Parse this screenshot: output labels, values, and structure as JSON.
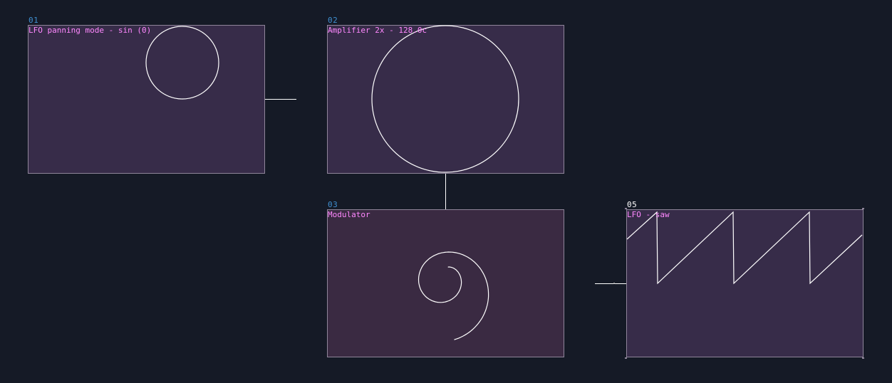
{
  "nodes": [
    {
      "id": "01",
      "title": "LFO panning mode - sin (0)",
      "fill": "#372c49",
      "active": false
    },
    {
      "id": "02",
      "title": "Amplifier 2x - 128.0c",
      "fill": "#372c49",
      "active": false
    },
    {
      "id": "03",
      "title": "Modulator",
      "fill": "#3a2a42",
      "active": false
    },
    {
      "id": "05",
      "title": "LFO - saw",
      "fill": "#372c49",
      "active": true
    }
  ],
  "colors": {
    "background": "#151a26",
    "node_border": "#8f859a",
    "node_id": "#3f8fd0",
    "node_id_active": "#ffffff",
    "title": "#ff88ff",
    "wave": "#ffffff",
    "wire": "#bbbbbb"
  }
}
